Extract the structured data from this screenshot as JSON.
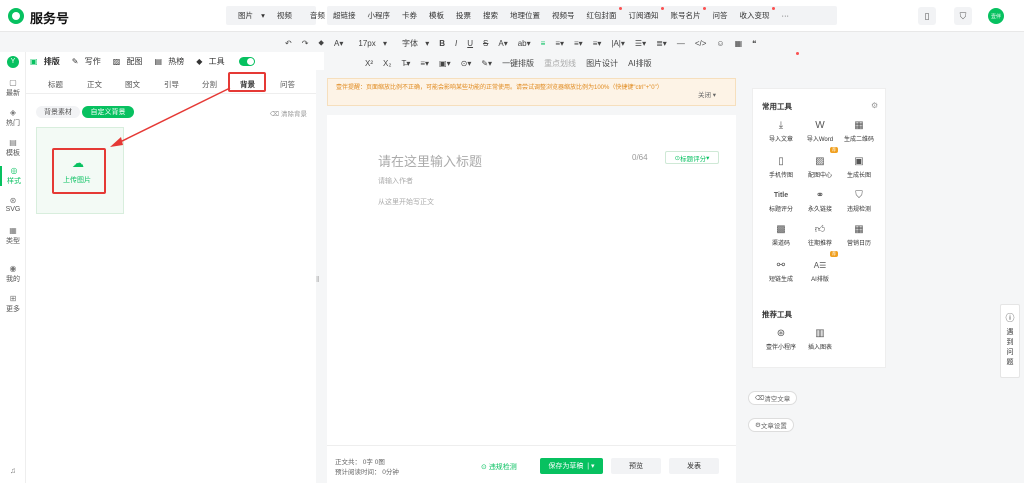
{
  "brand": {
    "name": "服务号"
  },
  "top_menu": {
    "group1": [
      "图片",
      "视频",
      "音频"
    ],
    "group2": [
      "超链接",
      "小程序",
      "卡券",
      "模板",
      "投票",
      "搜索",
      "地理位置",
      "视频号",
      "红包封面",
      "订阅通知",
      "账号名片",
      "问答",
      "收入变现"
    ],
    "more": "···",
    "avatar_text": "壹伴"
  },
  "toolbar": {
    "font_size": "17px",
    "font_family": "字体",
    "row1": [
      "↶",
      "↷",
      "⬥",
      "A",
      "17px ▾",
      "字体 ▾",
      "B",
      "I",
      "U",
      "S",
      "A",
      "ab",
      "≡",
      "≡",
      "≡",
      "≡",
      "≡",
      "|A|",
      "☰",
      "≣",
      "—",
      "</>",
      "☺",
      "▦",
      "❝"
    ],
    "row2": [
      "X²",
      "X₂",
      "T̶",
      "≡",
      "▣",
      "⊙",
      "✎",
      "一键排版",
      "重点划线",
      "图片设计",
      "AI排版"
    ]
  },
  "left_nav": [
    "最新",
    "热门",
    "模板",
    "样式",
    "SVG",
    "类型",
    "我的",
    "更多"
  ],
  "mode_bar": {
    "items": [
      "排版",
      "写作",
      "配图",
      "热榜",
      "工具"
    ]
  },
  "panel": {
    "tabs": [
      "标题",
      "正文",
      "图文",
      "引导",
      "分割",
      "背景",
      "问答"
    ],
    "sub_tabs": [
      "背景素材",
      "自定义背景"
    ],
    "clear_label": "清除背景",
    "upload_label": "上传图片"
  },
  "editor": {
    "notice": "壹伴提醒：页面缩放比例不正确，可能会影响某些功能的正常使用。请尝试调整浏览器缩放比例为100%（快捷键\"ctrl\"+\"0\"）",
    "notice_close": "关闭",
    "title_placeholder": "请在这里输入标题",
    "title_count": "0/64",
    "title_score": "标题评分",
    "author_placeholder": "请输入作者",
    "body_placeholder": "从这里开始写正文",
    "stats_words": "正文共：  0字 0图",
    "stats_time": "预计阅读时间：  0分钟",
    "check_label": "违规检测",
    "save_draft": "保存为草稿",
    "preview": "预览",
    "publish": "发表"
  },
  "tools": {
    "section1_title": "常用工具",
    "section2_title": "推荐工具",
    "items": [
      "导入文章",
      "导入Word",
      "生成二维码",
      "手机传图",
      "配图中心",
      "生成长图",
      "标题评分",
      "永久链接",
      "违规检测",
      "渠道码",
      "往期推荐",
      "营销日历",
      "短链生成",
      "AI排版"
    ],
    "recommend": [
      "壹伴小程序",
      "插入图表"
    ],
    "clear_article": "清空文章",
    "article_settings": "文章设置"
  },
  "help": {
    "label": "遇到问题"
  }
}
